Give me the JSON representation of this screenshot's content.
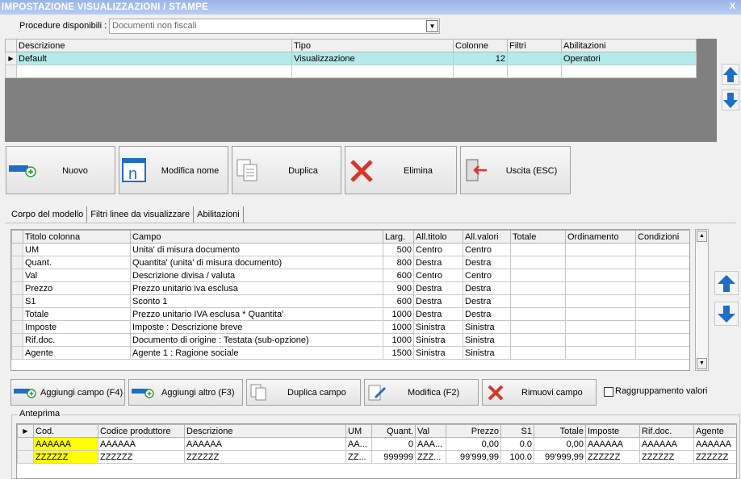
{
  "window": {
    "title": "IMPOSTAZIONE VISUALIZZAZIONI / STAMPE",
    "close_glyph": "X"
  },
  "procedure": {
    "label": "Procedure disponibili :",
    "value": "Documenti non fiscali"
  },
  "models_table": {
    "columns": [
      "Descrizione",
      "Tipo",
      "Colonne",
      "Filtri",
      "Abilitazioni"
    ],
    "rows": [
      {
        "descrizione": "Default",
        "tipo": "Visualizzazione",
        "colonne": "12",
        "filtri": "",
        "abilitazioni": "Operatori"
      }
    ]
  },
  "toolbar": {
    "nuovo": "Nuovo",
    "modifica_nome": "Modifica nome",
    "duplica": "Duplica",
    "elimina": "Elimina",
    "uscita": "Uscita (ESC)"
  },
  "tabs": [
    "Corpo del modello",
    "Filtri linee da visualizzare",
    "Abilitazioni"
  ],
  "fields_table": {
    "columns": [
      "Titolo colonna",
      "Campo",
      "Larg.",
      "All.titolo",
      "All.valori",
      "Totale",
      "Ordinamento",
      "Condizioni"
    ],
    "rows": [
      [
        "UM",
        "Unita' di misura documento",
        "500",
        "Centro",
        "Centro",
        "",
        "",
        ""
      ],
      [
        "Quant.",
        "Quantita' (unita' di misura documento)",
        "800",
        "Destra",
        "Destra",
        "",
        "",
        ""
      ],
      [
        "Val",
        "Descrizione divisa / valuta",
        "600",
        "Centro",
        "Centro",
        "",
        "",
        ""
      ],
      [
        "Prezzo",
        "Prezzo unitario iva esclusa",
        "900",
        "Destra",
        "Destra",
        "",
        "",
        ""
      ],
      [
        "S1",
        "Sconto 1",
        "600",
        "Destra",
        "Destra",
        "",
        "",
        ""
      ],
      [
        "Totale",
        "Prezzo unitario IVA esclusa * Quantita'",
        "1000",
        "Destra",
        "Destra",
        "",
        "",
        ""
      ],
      [
        "Imposte",
        "Imposte : Descrizione breve",
        "1000",
        "Sinistra",
        "Sinistra",
        "",
        "",
        ""
      ],
      [
        "Rif.doc.",
        "Documento di origine : Testata (sub-opzione)",
        "1000",
        "Sinistra",
        "Sinistra",
        "",
        "",
        ""
      ],
      [
        "Agente",
        "Agente 1 : Ragione sociale",
        "1500",
        "Sinistra",
        "Sinistra",
        "",
        "",
        ""
      ]
    ]
  },
  "field_buttons": {
    "aggiungi_campo": "Aggiungi campo (F4)",
    "aggiungi_altro": "Aggiungi altro (F3)",
    "duplica_campo": "Duplica campo",
    "modifica": "Modifica (F2)",
    "rimuovi_campo": "Rimuovi campo",
    "raggruppamento": "Raggruppamento valori"
  },
  "preview": {
    "label": "Anteprima",
    "columns": [
      "Cod.",
      "Codice produttore",
      "Descrizione",
      "UM",
      "Quant.",
      "Val",
      "Prezzo",
      "S1",
      "Totale",
      "Imposte",
      "Rif.doc.",
      "Agente"
    ],
    "rows": [
      [
        "AAAAAA",
        "AAAAAA",
        "AAAAAA",
        "AA...",
        "0",
        "AAA...",
        "0,00",
        "0.0",
        "0,00",
        "AAAAAA",
        "AAAAAA",
        "AAAAAA"
      ],
      [
        "ZZZZZZ",
        "ZZZZZZ",
        "ZZZZZZ",
        "ZZ...",
        "999999",
        "ZZZ...",
        "99'999,99",
        "100.0",
        "99'999,99",
        "ZZZZZZ",
        "ZZZZZZ",
        "ZZZZZZ"
      ]
    ]
  },
  "colors": {
    "title_bar": "#9bb3e8",
    "selected_row": "#b4eaea",
    "highlight": "#ffff00",
    "accent_blue": "#1c6fc4",
    "delete_red": "#d9342b"
  }
}
